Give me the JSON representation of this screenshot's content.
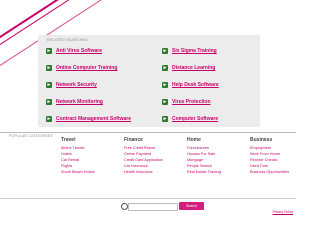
{
  "related": {
    "title": "RELATED SEARCHES",
    "left": [
      "Anti Virus Software",
      "Online Computer Training",
      "Network Security",
      "Network Monitoring",
      "Contract Management Software"
    ],
    "right": [
      "Six Sigma Training",
      "Distance Learning",
      "Help Desk Software",
      "Virus Protection",
      "Computer Software"
    ]
  },
  "categories": {
    "label": "POPULAR CATEGORIES",
    "columns": [
      {
        "head": "Travel",
        "items": [
          "Airline Tickets",
          "Hotels",
          "Car Rental",
          "Flights",
          "South Beach Hotels"
        ]
      },
      {
        "head": "Finance",
        "items": [
          "Free Credit Report",
          "Online Payment",
          "Credit Card Application",
          "Car Insurance",
          "Health Insurance"
        ]
      },
      {
        "head": "Home",
        "items": [
          "Foreclosures",
          "Houses For Sale",
          "Mortgage",
          "People Search",
          "Real Estate Training"
        ]
      },
      {
        "head": "Business",
        "items": [
          "Employment",
          "Work From Home",
          "Reorder Checks",
          "Used Cars",
          "Business Opportunities"
        ]
      }
    ]
  },
  "search": {
    "button": "Search",
    "placeholder": ""
  },
  "footer": {
    "privacy": "Privacy Policy"
  },
  "colors": {
    "accent": "#c8006a",
    "arrow": "#2f7a2f",
    "button": "#d21f7d"
  }
}
